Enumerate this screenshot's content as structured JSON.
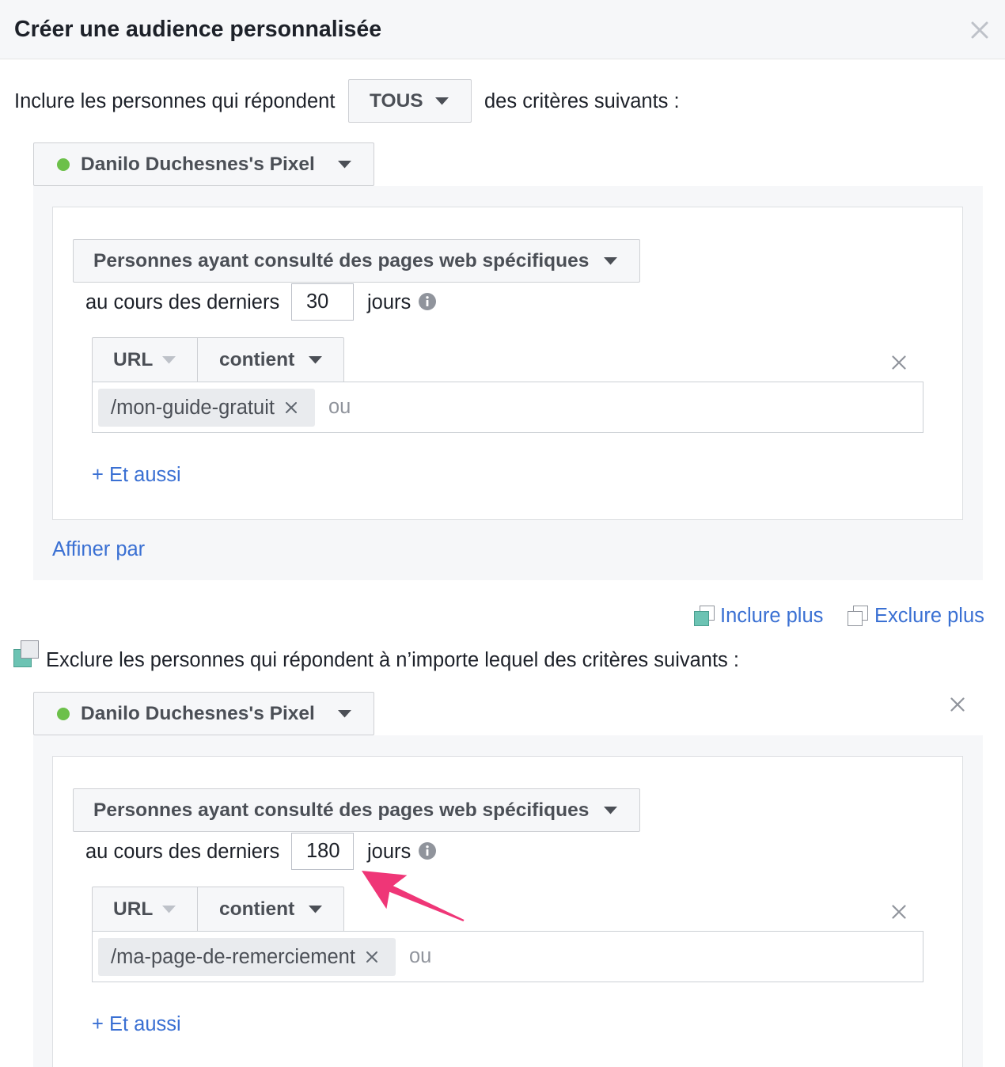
{
  "dialog": {
    "title": "Créer une audience personnalisée",
    "close_icon": "close-icon"
  },
  "include": {
    "prefix": "Inclure les personnes qui répondent",
    "match": "TOUS",
    "suffix": "des critères suivants :",
    "source": {
      "name": "Danilo Duchesnes's Pixel",
      "status_color": "#6cc04a"
    },
    "rule": {
      "event": "Personnes ayant consulté des pages web spécifiques",
      "retention_prefix": "au cours des derniers",
      "retention_days": "30",
      "retention_unit": "jours",
      "filter_field": "URL",
      "filter_operator": "contient",
      "values": [
        "/mon-guide-gratuit"
      ],
      "value_placeholder": "ou",
      "add_condition": "+ Et aussi"
    },
    "refine": "Affiner par"
  },
  "actions": {
    "include_more": "Inclure plus",
    "exclude_more": "Exclure plus"
  },
  "exclude": {
    "label": "Exclure les personnes qui répondent à n’importe lequel des critères suivants :",
    "source": {
      "name": "Danilo Duchesnes's Pixel",
      "status_color": "#6cc04a"
    },
    "rule": {
      "event": "Personnes ayant consulté des pages web spécifiques",
      "retention_prefix": "au cours des derniers",
      "retention_days": "180",
      "retention_unit": "jours",
      "filter_field": "URL",
      "filter_operator": "contient",
      "values": [
        "/ma-page-de-remerciement"
      ],
      "value_placeholder": "ou",
      "add_condition": "+ Et aussi"
    }
  },
  "theme": {
    "link_color": "#3a70d3",
    "include_icon_color": "#6cc3b3",
    "annotation_color": "#ef3677"
  },
  "icons": {
    "dropdown": "chevron-down-icon",
    "info": "info-icon",
    "remove": "close-icon",
    "include_more": "include-squares-icon",
    "exclude_more": "exclude-squares-icon"
  }
}
